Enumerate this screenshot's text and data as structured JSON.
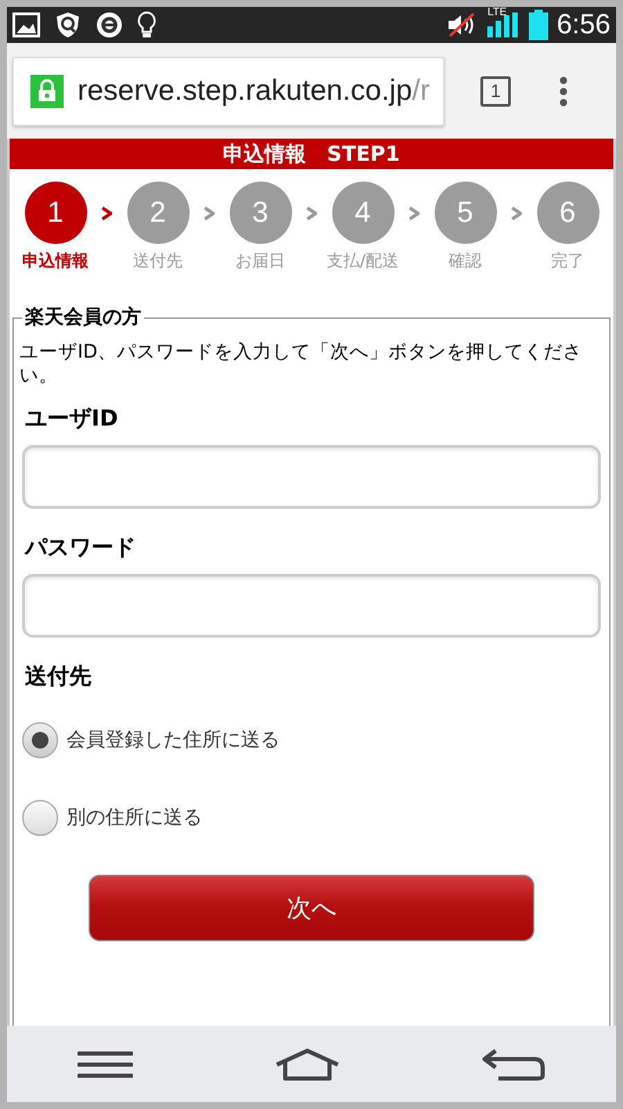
{
  "status_bar": {
    "time": "6:56",
    "network": "LTE"
  },
  "browser": {
    "url_host": "reserve.step.rakuten.co.jp",
    "url_rest": "/r",
    "tab_count": "1"
  },
  "header": {
    "title": "申込情報　STEP1"
  },
  "steps": [
    {
      "number": "1",
      "label": "申込情報",
      "selected": true
    },
    {
      "number": "2",
      "label": "送付先",
      "selected": false
    },
    {
      "number": "3",
      "label": "お届日",
      "selected": false
    },
    {
      "number": "4",
      "label": "支払/配送",
      "selected": false
    },
    {
      "number": "5",
      "label": "確認",
      "selected": false
    },
    {
      "number": "6",
      "label": "完了",
      "selected": false
    }
  ],
  "member_section": {
    "legend": "楽天会員の方",
    "description": "ユーザID、パスワードを入力して「次へ」ボタンを押してください。",
    "fields": [
      {
        "label": "ユーザID"
      },
      {
        "label": "パスワード"
      }
    ],
    "shipping": {
      "label": "送付先",
      "options": [
        {
          "label": "会員登録した住所に送る",
          "selected": true
        },
        {
          "label": "別の住所に送る",
          "selected": false
        }
      ]
    },
    "next_button": "次へ"
  }
}
